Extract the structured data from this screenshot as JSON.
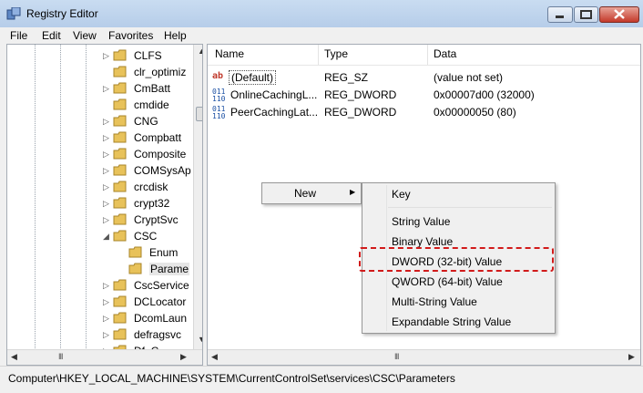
{
  "window": {
    "title": "Registry Editor",
    "controls": {
      "minimize": "─",
      "maximize": "□",
      "close": "✕"
    }
  },
  "menu": [
    "File",
    "Edit",
    "View",
    "Favorites",
    "Help"
  ],
  "tree": {
    "items": [
      {
        "label": "CLFS",
        "expander": "▷"
      },
      {
        "label": "clr_optimiz",
        "expander": ""
      },
      {
        "label": "CmBatt",
        "expander": "▷"
      },
      {
        "label": "cmdide",
        "expander": ""
      },
      {
        "label": "CNG",
        "expander": "▷"
      },
      {
        "label": "Compbatt",
        "expander": "▷"
      },
      {
        "label": "Composite",
        "expander": "▷"
      },
      {
        "label": "COMSysAp",
        "expander": "▷"
      },
      {
        "label": "crcdisk",
        "expander": "▷"
      },
      {
        "label": "crypt32",
        "expander": "▷"
      },
      {
        "label": "CryptSvc",
        "expander": "▷"
      },
      {
        "label": "CSC",
        "expander": "◢"
      },
      {
        "label": "Enum",
        "expander": ""
      },
      {
        "label": "Parame",
        "expander": ""
      },
      {
        "label": "CscService",
        "expander": "▷"
      },
      {
        "label": "DCLocator",
        "expander": "▷"
      },
      {
        "label": "DcomLaun",
        "expander": "▷"
      },
      {
        "label": "defragsvc",
        "expander": "▷"
      },
      {
        "label": "Df. C...",
        "expander": "▷"
      }
    ],
    "hscroll": {
      "left": "◀",
      "right": "▶",
      "grip": "III"
    },
    "vscroll": {
      "up": "▲",
      "down": "▼"
    }
  },
  "list": {
    "columns": [
      "Name",
      "Type",
      "Data"
    ],
    "rows": [
      {
        "icon": "ab",
        "name": "(Default)",
        "type": "REG_SZ",
        "data": "(value not set)"
      },
      {
        "icon": "011\n110",
        "name": "OnlineCachingL...",
        "type": "REG_DWORD",
        "data": "0x00007d00 (32000)"
      },
      {
        "icon": "011\n110",
        "name": "PeerCachingLat...",
        "type": "REG_DWORD",
        "data": "0x00000050 (80)"
      }
    ],
    "hscroll": {
      "left": "◀",
      "right": "▶",
      "grip": "III"
    }
  },
  "context_menu": {
    "new_label": "New",
    "arrow": "▶"
  },
  "submenu": {
    "key": "Key",
    "items": [
      "String Value",
      "Binary Value",
      "DWORD (32-bit) Value",
      "QWORD (64-bit) Value",
      "Multi-String Value",
      "Expandable String Value"
    ]
  },
  "status": "Computer\\HKEY_LOCAL_MACHINE\\SYSTEM\\CurrentControlSet\\services\\CSC\\Parameters",
  "colors": {
    "highlight": "#d11a1a",
    "folder": "#e8c25a",
    "title_bar": "#c9dcf1"
  }
}
